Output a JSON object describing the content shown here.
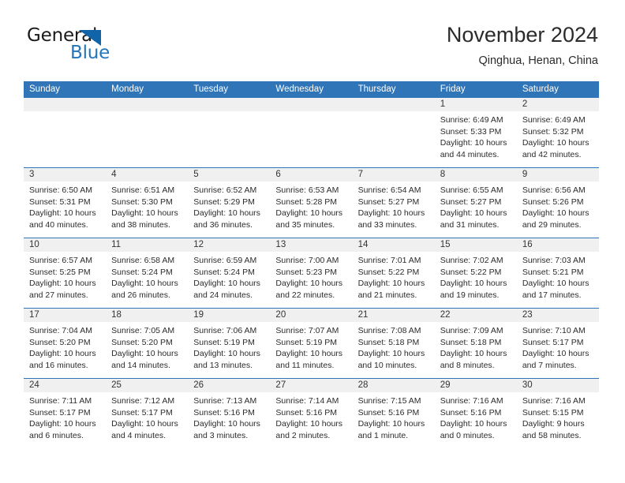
{
  "logo": {
    "text_top": "General",
    "text_bottom": "Blue",
    "triangle_color": "#1164a8",
    "blue_color": "#2176bd"
  },
  "header": {
    "title": "November 2024",
    "subtitle": "Qinghua, Henan, China"
  },
  "theme": {
    "header_blue": "#3075b8",
    "day_band_gray": "#f0f0f0"
  },
  "weekdays": [
    "Sunday",
    "Monday",
    "Tuesday",
    "Wednesday",
    "Thursday",
    "Friday",
    "Saturday"
  ],
  "weeks": [
    [
      {
        "day": "",
        "sunrise": "",
        "sunset": "",
        "daylight1": "",
        "daylight2": "",
        "empty": true
      },
      {
        "day": "",
        "sunrise": "",
        "sunset": "",
        "daylight1": "",
        "daylight2": "",
        "empty": true
      },
      {
        "day": "",
        "sunrise": "",
        "sunset": "",
        "daylight1": "",
        "daylight2": "",
        "empty": true
      },
      {
        "day": "",
        "sunrise": "",
        "sunset": "",
        "daylight1": "",
        "daylight2": "",
        "empty": true
      },
      {
        "day": "",
        "sunrise": "",
        "sunset": "",
        "daylight1": "",
        "daylight2": "",
        "empty": true
      },
      {
        "day": "1",
        "sunrise": "Sunrise: 6:49 AM",
        "sunset": "Sunset: 5:33 PM",
        "daylight1": "Daylight: 10 hours",
        "daylight2": "and 44 minutes."
      },
      {
        "day": "2",
        "sunrise": "Sunrise: 6:49 AM",
        "sunset": "Sunset: 5:32 PM",
        "daylight1": "Daylight: 10 hours",
        "daylight2": "and 42 minutes."
      }
    ],
    [
      {
        "day": "3",
        "sunrise": "Sunrise: 6:50 AM",
        "sunset": "Sunset: 5:31 PM",
        "daylight1": "Daylight: 10 hours",
        "daylight2": "and 40 minutes."
      },
      {
        "day": "4",
        "sunrise": "Sunrise: 6:51 AM",
        "sunset": "Sunset: 5:30 PM",
        "daylight1": "Daylight: 10 hours",
        "daylight2": "and 38 minutes."
      },
      {
        "day": "5",
        "sunrise": "Sunrise: 6:52 AM",
        "sunset": "Sunset: 5:29 PM",
        "daylight1": "Daylight: 10 hours",
        "daylight2": "and 36 minutes."
      },
      {
        "day": "6",
        "sunrise": "Sunrise: 6:53 AM",
        "sunset": "Sunset: 5:28 PM",
        "daylight1": "Daylight: 10 hours",
        "daylight2": "and 35 minutes."
      },
      {
        "day": "7",
        "sunrise": "Sunrise: 6:54 AM",
        "sunset": "Sunset: 5:27 PM",
        "daylight1": "Daylight: 10 hours",
        "daylight2": "and 33 minutes."
      },
      {
        "day": "8",
        "sunrise": "Sunrise: 6:55 AM",
        "sunset": "Sunset: 5:27 PM",
        "daylight1": "Daylight: 10 hours",
        "daylight2": "and 31 minutes."
      },
      {
        "day": "9",
        "sunrise": "Sunrise: 6:56 AM",
        "sunset": "Sunset: 5:26 PM",
        "daylight1": "Daylight: 10 hours",
        "daylight2": "and 29 minutes."
      }
    ],
    [
      {
        "day": "10",
        "sunrise": "Sunrise: 6:57 AM",
        "sunset": "Sunset: 5:25 PM",
        "daylight1": "Daylight: 10 hours",
        "daylight2": "and 27 minutes."
      },
      {
        "day": "11",
        "sunrise": "Sunrise: 6:58 AM",
        "sunset": "Sunset: 5:24 PM",
        "daylight1": "Daylight: 10 hours",
        "daylight2": "and 26 minutes."
      },
      {
        "day": "12",
        "sunrise": "Sunrise: 6:59 AM",
        "sunset": "Sunset: 5:24 PM",
        "daylight1": "Daylight: 10 hours",
        "daylight2": "and 24 minutes."
      },
      {
        "day": "13",
        "sunrise": "Sunrise: 7:00 AM",
        "sunset": "Sunset: 5:23 PM",
        "daylight1": "Daylight: 10 hours",
        "daylight2": "and 22 minutes."
      },
      {
        "day": "14",
        "sunrise": "Sunrise: 7:01 AM",
        "sunset": "Sunset: 5:22 PM",
        "daylight1": "Daylight: 10 hours",
        "daylight2": "and 21 minutes."
      },
      {
        "day": "15",
        "sunrise": "Sunrise: 7:02 AM",
        "sunset": "Sunset: 5:22 PM",
        "daylight1": "Daylight: 10 hours",
        "daylight2": "and 19 minutes."
      },
      {
        "day": "16",
        "sunrise": "Sunrise: 7:03 AM",
        "sunset": "Sunset: 5:21 PM",
        "daylight1": "Daylight: 10 hours",
        "daylight2": "and 17 minutes."
      }
    ],
    [
      {
        "day": "17",
        "sunrise": "Sunrise: 7:04 AM",
        "sunset": "Sunset: 5:20 PM",
        "daylight1": "Daylight: 10 hours",
        "daylight2": "and 16 minutes."
      },
      {
        "day": "18",
        "sunrise": "Sunrise: 7:05 AM",
        "sunset": "Sunset: 5:20 PM",
        "daylight1": "Daylight: 10 hours",
        "daylight2": "and 14 minutes."
      },
      {
        "day": "19",
        "sunrise": "Sunrise: 7:06 AM",
        "sunset": "Sunset: 5:19 PM",
        "daylight1": "Daylight: 10 hours",
        "daylight2": "and 13 minutes."
      },
      {
        "day": "20",
        "sunrise": "Sunrise: 7:07 AM",
        "sunset": "Sunset: 5:19 PM",
        "daylight1": "Daylight: 10 hours",
        "daylight2": "and 11 minutes."
      },
      {
        "day": "21",
        "sunrise": "Sunrise: 7:08 AM",
        "sunset": "Sunset: 5:18 PM",
        "daylight1": "Daylight: 10 hours",
        "daylight2": "and 10 minutes."
      },
      {
        "day": "22",
        "sunrise": "Sunrise: 7:09 AM",
        "sunset": "Sunset: 5:18 PM",
        "daylight1": "Daylight: 10 hours",
        "daylight2": "and 8 minutes."
      },
      {
        "day": "23",
        "sunrise": "Sunrise: 7:10 AM",
        "sunset": "Sunset: 5:17 PM",
        "daylight1": "Daylight: 10 hours",
        "daylight2": "and 7 minutes."
      }
    ],
    [
      {
        "day": "24",
        "sunrise": "Sunrise: 7:11 AM",
        "sunset": "Sunset: 5:17 PM",
        "daylight1": "Daylight: 10 hours",
        "daylight2": "and 6 minutes."
      },
      {
        "day": "25",
        "sunrise": "Sunrise: 7:12 AM",
        "sunset": "Sunset: 5:17 PM",
        "daylight1": "Daylight: 10 hours",
        "daylight2": "and 4 minutes."
      },
      {
        "day": "26",
        "sunrise": "Sunrise: 7:13 AM",
        "sunset": "Sunset: 5:16 PM",
        "daylight1": "Daylight: 10 hours",
        "daylight2": "and 3 minutes."
      },
      {
        "day": "27",
        "sunrise": "Sunrise: 7:14 AM",
        "sunset": "Sunset: 5:16 PM",
        "daylight1": "Daylight: 10 hours",
        "daylight2": "and 2 minutes."
      },
      {
        "day": "28",
        "sunrise": "Sunrise: 7:15 AM",
        "sunset": "Sunset: 5:16 PM",
        "daylight1": "Daylight: 10 hours",
        "daylight2": "and 1 minute."
      },
      {
        "day": "29",
        "sunrise": "Sunrise: 7:16 AM",
        "sunset": "Sunset: 5:16 PM",
        "daylight1": "Daylight: 10 hours",
        "daylight2": "and 0 minutes."
      },
      {
        "day": "30",
        "sunrise": "Sunrise: 7:16 AM",
        "sunset": "Sunset: 5:15 PM",
        "daylight1": "Daylight: 9 hours",
        "daylight2": "and 58 minutes."
      }
    ]
  ]
}
